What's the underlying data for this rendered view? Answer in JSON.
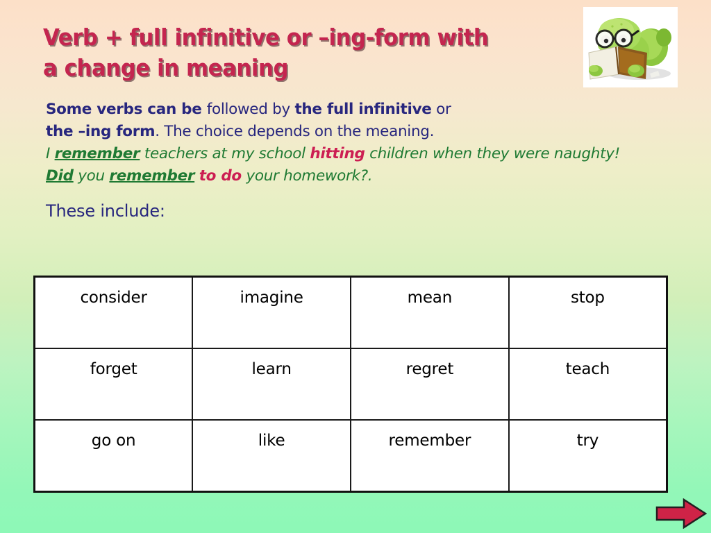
{
  "slide": {
    "title": "Verb + full infinitive or –ing-form with\na change in meaning",
    "title_color": "#c4254f",
    "background_top_color": "#fce0c8",
    "background_bottom_color": "#8df8b7"
  },
  "body": {
    "line1": [
      {
        "text": "Some verbs can be ",
        "style": "navy-bold"
      },
      {
        "text": " followed by ",
        "style": "navy"
      },
      {
        "text": "the full infinitive",
        "style": "navy-bold"
      },
      {
        "text": " or",
        "style": "navy"
      }
    ],
    "line2": [
      {
        "text": "the –ing form",
        "style": "navy-bold"
      },
      {
        "text": ". The choice depends on the meaning.",
        "style": "navy"
      }
    ],
    "line3": [
      {
        "text": "I ",
        "style": "green-italic"
      },
      {
        "text": "remember",
        "style": "green-bold-underline"
      },
      {
        "text": " teachers at my school ",
        "style": "green-italic"
      },
      {
        "text": "hitting",
        "style": "crimson-bold"
      },
      {
        "text": " children when they were naughty!",
        "style": "green-italic"
      }
    ],
    "line4": [
      {
        "text": "Did",
        "style": "green-bold-underline"
      },
      {
        "text": " you ",
        "style": "green-italic"
      },
      {
        "text": "remember",
        "style": "green-bold-underline"
      },
      {
        "text": " ",
        "style": "green-italic"
      },
      {
        "text": "to do",
        "style": "crimson-bold"
      },
      {
        "text": " your homework?.",
        "style": "green-italic"
      }
    ],
    "line5": "These include:",
    "navy_color": "#27267e",
    "green_color": "#1f7a33",
    "crimson_color": "#cc1e52"
  },
  "clipart": {
    "name": "caterpillar-reading-book",
    "description": "green cartoon caterpillar with glasses reading a brown book"
  },
  "table": {
    "rows": [
      [
        "consider",
        "imagine",
        "mean",
        "stop"
      ],
      [
        "forget",
        "learn",
        "regret",
        "teach"
      ],
      [
        "go on",
        "like",
        "remember",
        "try"
      ]
    ]
  },
  "navigation": {
    "next_arrow_label": "next",
    "arrow_color": "#cf2347"
  }
}
